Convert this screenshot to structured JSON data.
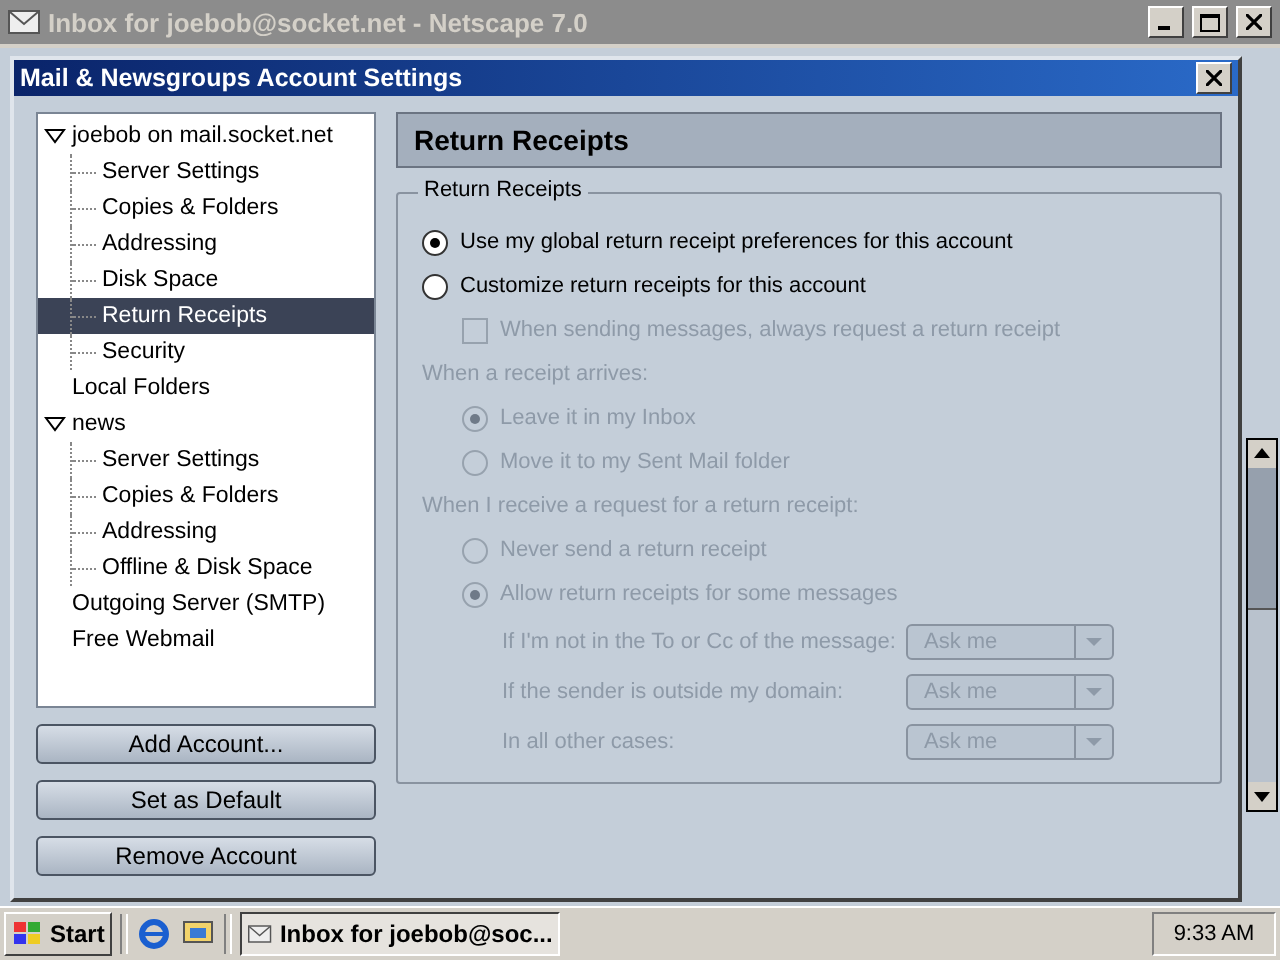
{
  "background_window": {
    "title": "Inbox for joebob@socket.net - Netscape 7.0",
    "active": false
  },
  "dialog": {
    "title": "Mail & Newsgroups Account Settings"
  },
  "account_tree": [
    {
      "label": "joebob on mail.socket.net",
      "expanded": true,
      "selected": false,
      "children": [
        {
          "label": "Server Settings",
          "selected": false
        },
        {
          "label": "Copies & Folders",
          "selected": false
        },
        {
          "label": "Addressing",
          "selected": false
        },
        {
          "label": "Disk Space",
          "selected": false
        },
        {
          "label": "Return Receipts",
          "selected": true
        },
        {
          "label": "Security",
          "selected": false
        }
      ]
    },
    {
      "label": "Local Folders",
      "selected": false
    },
    {
      "label": "news",
      "expanded": true,
      "selected": false,
      "children": [
        {
          "label": "Server Settings",
          "selected": false
        },
        {
          "label": "Copies & Folders",
          "selected": false
        },
        {
          "label": "Addressing",
          "selected": false
        },
        {
          "label": "Offline & Disk Space",
          "selected": false
        }
      ]
    },
    {
      "label": "Outgoing Server (SMTP)",
      "selected": false
    },
    {
      "label": "Free Webmail",
      "selected": false
    }
  ],
  "account_buttons": [
    "Add Account...",
    "Set as Default",
    "Remove Account"
  ],
  "panel": {
    "header": "Return Receipts",
    "group_label": "Return Receipts",
    "items": [
      {
        "kind": "radio",
        "label": "Use my global return receipt preferences for this account",
        "selected": true,
        "disabled": false
      },
      {
        "kind": "radio",
        "label": "Customize return receipts for this account",
        "selected": false,
        "disabled": false,
        "children": [
          {
            "kind": "checkbox",
            "label": "When sending messages, always request a return receipt",
            "checked": false,
            "disabled": true
          },
          {
            "kind": "caption",
            "label": "When a receipt arrives:",
            "disabled": true
          },
          {
            "kind": "radio",
            "label": "Leave it in my Inbox",
            "selected": true,
            "disabled": true
          },
          {
            "kind": "radio",
            "label": "Move it to my Sent Mail folder",
            "selected": false,
            "disabled": true
          },
          {
            "kind": "caption",
            "label": "When I receive a request for a return receipt:",
            "disabled": true
          },
          {
            "kind": "radio",
            "label": "Never send a return receipt",
            "selected": false,
            "disabled": true
          },
          {
            "kind": "radio",
            "label": "Allow return receipts for some messages",
            "selected": true,
            "disabled": true,
            "children": [
              {
                "kind": "dropdown",
                "label": "If I'm not in the To or Cc of the message:",
                "value": "Ask me",
                "disabled": true
              },
              {
                "kind": "dropdown",
                "label": "If the sender is outside my domain:",
                "value": "Ask me",
                "disabled": true
              },
              {
                "kind": "dropdown",
                "label": "In all other cases:",
                "value": "Ask me",
                "disabled": true
              }
            ]
          }
        ]
      }
    ]
  },
  "taskbar": {
    "start": "Start",
    "task": "Inbox for joebob@soc...",
    "clock": "9:33 AM"
  }
}
